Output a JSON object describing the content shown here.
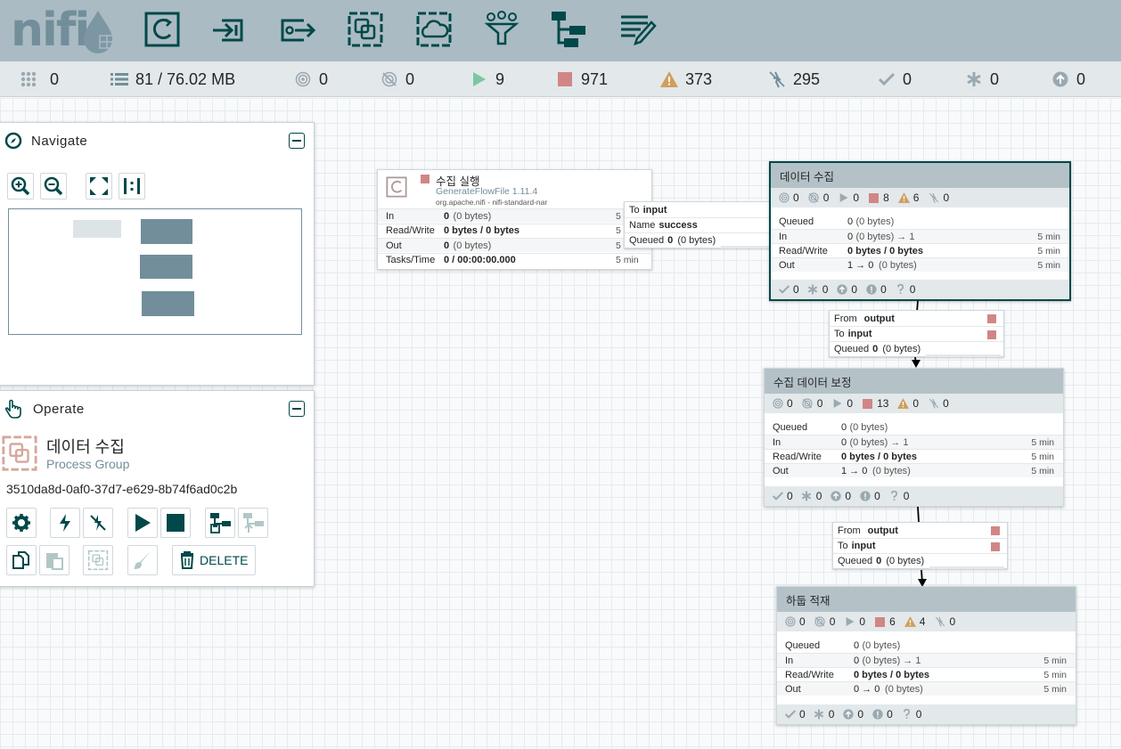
{
  "header": {
    "logo_text": "nifi",
    "tools": [
      "processor-tool",
      "input-port-tool",
      "output-port-tool",
      "process-group-tool",
      "remote-process-group-tool",
      "funnel-tool",
      "template-tool",
      "label-tool"
    ]
  },
  "status": {
    "threads": "0",
    "queued": "81 / 76.02 MB",
    "transmitting": "0",
    "not_transmitting": "0",
    "running": "9",
    "stopped": "971",
    "invalid": "373",
    "disabled": "295",
    "up_to_date": "0",
    "locally_modified": "0",
    "sync_failure": "0"
  },
  "navigate": {
    "title": "Navigate"
  },
  "operate": {
    "title": "Operate",
    "selection_name": "데이터 수집",
    "selection_type": "Process Group",
    "selection_id": "3510da8d-0af0-37d7-e629-8b74f6ad0c2b",
    "delete_label": "DELETE"
  },
  "processor": {
    "name": "수집 실행",
    "type": "GenerateFlowFile 1.11.4",
    "bundle": "org.apache.nifi - nifi-standard-nar",
    "rows": [
      {
        "k": "In",
        "v": "0",
        "d": " (0 bytes)",
        "t": "5"
      },
      {
        "k": "Read/Write",
        "v": "0 bytes / 0 bytes",
        "d": "",
        "t": "5"
      },
      {
        "k": "Out",
        "v": "0",
        "d": " (0 bytes)",
        "t": "5"
      },
      {
        "k": "Tasks/Time",
        "v": "0 / 00:00:00.000",
        "d": "",
        "t": "5 min"
      }
    ]
  },
  "conn1": {
    "to_label": "To",
    "to": "input",
    "name_label": "Name",
    "name": "success",
    "queued_label": "Queued",
    "queued": "0",
    "queued_d": " (0 bytes)"
  },
  "conn2": {
    "from_label": "From",
    "from": "output",
    "to_label": "To",
    "to": "input",
    "queued_label": "Queued",
    "queued": "0",
    "queued_d": " (0 bytes)"
  },
  "conn3": {
    "from_label": "From",
    "from": "output",
    "to_label": "To",
    "to": "input",
    "queued_label": "Queued",
    "queued": "0",
    "queued_d": " (0 bytes)"
  },
  "groups": [
    {
      "name": "데이터 수집",
      "stats": {
        "tx": "0",
        "ntx": "0",
        "run": "0",
        "stop": "8",
        "inv": "6",
        "dis": "0"
      },
      "rows": [
        {
          "k": "Queued",
          "v": "0",
          "d": " (0 bytes)",
          "t": ""
        },
        {
          "k": "In",
          "v": "0",
          "d": " (0 bytes) → 1",
          "t": "5 min"
        },
        {
          "k": "Read/Write",
          "v": "0 bytes / 0 bytes",
          "d": "",
          "t": "5 min"
        },
        {
          "k": "Out",
          "v": "1 → 0",
          "d": " (0 bytes)",
          "t": "5 min"
        }
      ],
      "foot": {
        "uptodate": "0",
        "modified": "0",
        "stale": "0",
        "error": "0",
        "unknown": "0"
      }
    },
    {
      "name": "수집 데이터 보정",
      "stats": {
        "tx": "0",
        "ntx": "0",
        "run": "0",
        "stop": "13",
        "inv": "0",
        "dis": "0"
      },
      "rows": [
        {
          "k": "Queued",
          "v": "0",
          "d": " (0 bytes)",
          "t": ""
        },
        {
          "k": "In",
          "v": "0",
          "d": " (0 bytes) → 1",
          "t": "5 min"
        },
        {
          "k": "Read/Write",
          "v": "0 bytes / 0 bytes",
          "d": "",
          "t": "5 min"
        },
        {
          "k": "Out",
          "v": "1 → 0",
          "d": " (0 bytes)",
          "t": "5 min"
        }
      ],
      "foot": {
        "uptodate": "0",
        "modified": "0",
        "stale": "0",
        "error": "0",
        "unknown": "0"
      }
    },
    {
      "name": "하둡 적재",
      "stats": {
        "tx": "0",
        "ntx": "0",
        "run": "0",
        "stop": "6",
        "inv": "4",
        "dis": "0"
      },
      "rows": [
        {
          "k": "Queued",
          "v": "0",
          "d": " (0 bytes)",
          "t": ""
        },
        {
          "k": "In",
          "v": "0",
          "d": " (0 bytes) → 1",
          "t": "5 min"
        },
        {
          "k": "Read/Write",
          "v": "0 bytes / 0 bytes",
          "d": "",
          "t": "5 min"
        },
        {
          "k": "Out",
          "v": "0 → 0",
          "d": " (0 bytes)",
          "t": "5 min"
        }
      ],
      "foot": {
        "uptodate": "0",
        "modified": "0",
        "stale": "0",
        "error": "0",
        "unknown": "0"
      }
    }
  ],
  "colors": {
    "header": "#aabbc3",
    "accent": "#004849",
    "stopped": "#d18686",
    "running": "#7dc7a0",
    "invalid": "#cf9f5d"
  }
}
